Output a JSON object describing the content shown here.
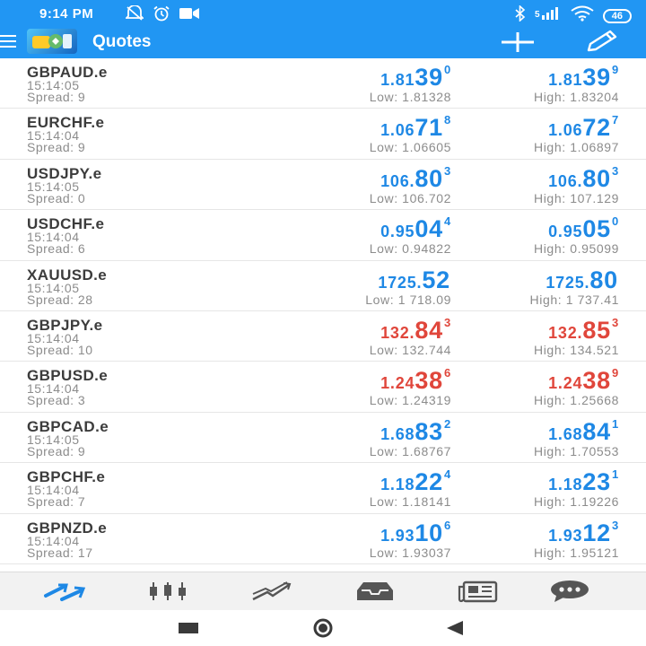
{
  "status_bar": {
    "time": "9:14 PM",
    "battery": "46",
    "icons": [
      "mute-icon",
      "alarm-icon",
      "video-icon",
      "bluetooth-icon",
      "signal-icon",
      "wifi-icon",
      "battery-icon"
    ]
  },
  "app_bar": {
    "title": "Quotes",
    "actions": [
      "add-icon",
      "edit-icon"
    ]
  },
  "quotes": [
    {
      "symbol": "GBPAUD.e",
      "time": "15:14:05",
      "spread": "Spread: 9",
      "bid": {
        "small": "1.81",
        "big": "39",
        "sup": "0"
      },
      "ask": {
        "small": "1.81",
        "big": "39",
        "sup": "9"
      },
      "low": "Low: 1.81328",
      "high": "High: 1.83204",
      "direction": "up"
    },
    {
      "symbol": "EURCHF.e",
      "time": "15:14:04",
      "spread": "Spread: 9",
      "bid": {
        "small": "1.06",
        "big": "71",
        "sup": "8"
      },
      "ask": {
        "small": "1.06",
        "big": "72",
        "sup": "7"
      },
      "low": "Low: 1.06605",
      "high": "High: 1.06897",
      "direction": "up"
    },
    {
      "symbol": "USDJPY.e",
      "time": "15:14:05",
      "spread": "Spread: 0",
      "bid": {
        "small": "106.",
        "big": "80",
        "sup": "3"
      },
      "ask": {
        "small": "106.",
        "big": "80",
        "sup": "3"
      },
      "low": "Low: 106.702",
      "high": "High: 107.129",
      "direction": "up"
    },
    {
      "symbol": "USDCHF.e",
      "time": "15:14:04",
      "spread": "Spread: 6",
      "bid": {
        "small": "0.95",
        "big": "04",
        "sup": "4"
      },
      "ask": {
        "small": "0.95",
        "big": "05",
        "sup": "0"
      },
      "low": "Low: 0.94822",
      "high": "High: 0.95099",
      "direction": "up"
    },
    {
      "symbol": "XAUUSD.e",
      "time": "15:14:05",
      "spread": "Spread: 28",
      "bid": {
        "small": "1725.",
        "big": "52",
        "sup": ""
      },
      "ask": {
        "small": "1725.",
        "big": "80",
        "sup": ""
      },
      "low": "Low: 1 718.09",
      "high": "High: 1 737.41",
      "direction": "up"
    },
    {
      "symbol": "GBPJPY.e",
      "time": "15:14:04",
      "spread": "Spread: 10",
      "bid": {
        "small": "132.",
        "big": "84",
        "sup": "3"
      },
      "ask": {
        "small": "132.",
        "big": "85",
        "sup": "3"
      },
      "low": "Low: 132.744",
      "high": "High: 134.521",
      "direction": "down"
    },
    {
      "symbol": "GBPUSD.e",
      "time": "15:14:04",
      "spread": "Spread: 3",
      "bid": {
        "small": "1.24",
        "big": "38",
        "sup": "6"
      },
      "ask": {
        "small": "1.24",
        "big": "38",
        "sup": "9"
      },
      "low": "Low: 1.24319",
      "high": "High: 1.25668",
      "direction": "down"
    },
    {
      "symbol": "GBPCAD.e",
      "time": "15:14:05",
      "spread": "Spread: 9",
      "bid": {
        "small": "1.68",
        "big": "83",
        "sup": "2"
      },
      "ask": {
        "small": "1.68",
        "big": "84",
        "sup": "1"
      },
      "low": "Low: 1.68767",
      "high": "High: 1.70553",
      "direction": "up"
    },
    {
      "symbol": "GBPCHF.e",
      "time": "15:14:04",
      "spread": "Spread: 7",
      "bid": {
        "small": "1.18",
        "big": "22",
        "sup": "4"
      },
      "ask": {
        "small": "1.18",
        "big": "23",
        "sup": "1"
      },
      "low": "Low: 1.18141",
      "high": "High: 1.19226",
      "direction": "up"
    },
    {
      "symbol": "GBPNZD.e",
      "time": "15:14:04",
      "spread": "Spread: 17",
      "bid": {
        "small": "1.93",
        "big": "10",
        "sup": "6"
      },
      "ask": {
        "small": "1.93",
        "big": "12",
        "sup": "3"
      },
      "low": "Low: 1.93037",
      "high": "High: 1.95121",
      "direction": "up"
    }
  ],
  "bottom_tabs": [
    {
      "icon": "quotes-icon",
      "active": true
    },
    {
      "icon": "chart-candles-icon",
      "active": false
    },
    {
      "icon": "trade-icon",
      "active": false
    },
    {
      "icon": "history-icon",
      "active": false
    },
    {
      "icon": "news-icon",
      "active": false
    },
    {
      "icon": "messages-icon",
      "active": false
    }
  ],
  "colors": {
    "brand": "#2196f3",
    "price_up": "#1e88e5",
    "price_down": "#e0463b",
    "muted_text": "#8c8c8c"
  }
}
